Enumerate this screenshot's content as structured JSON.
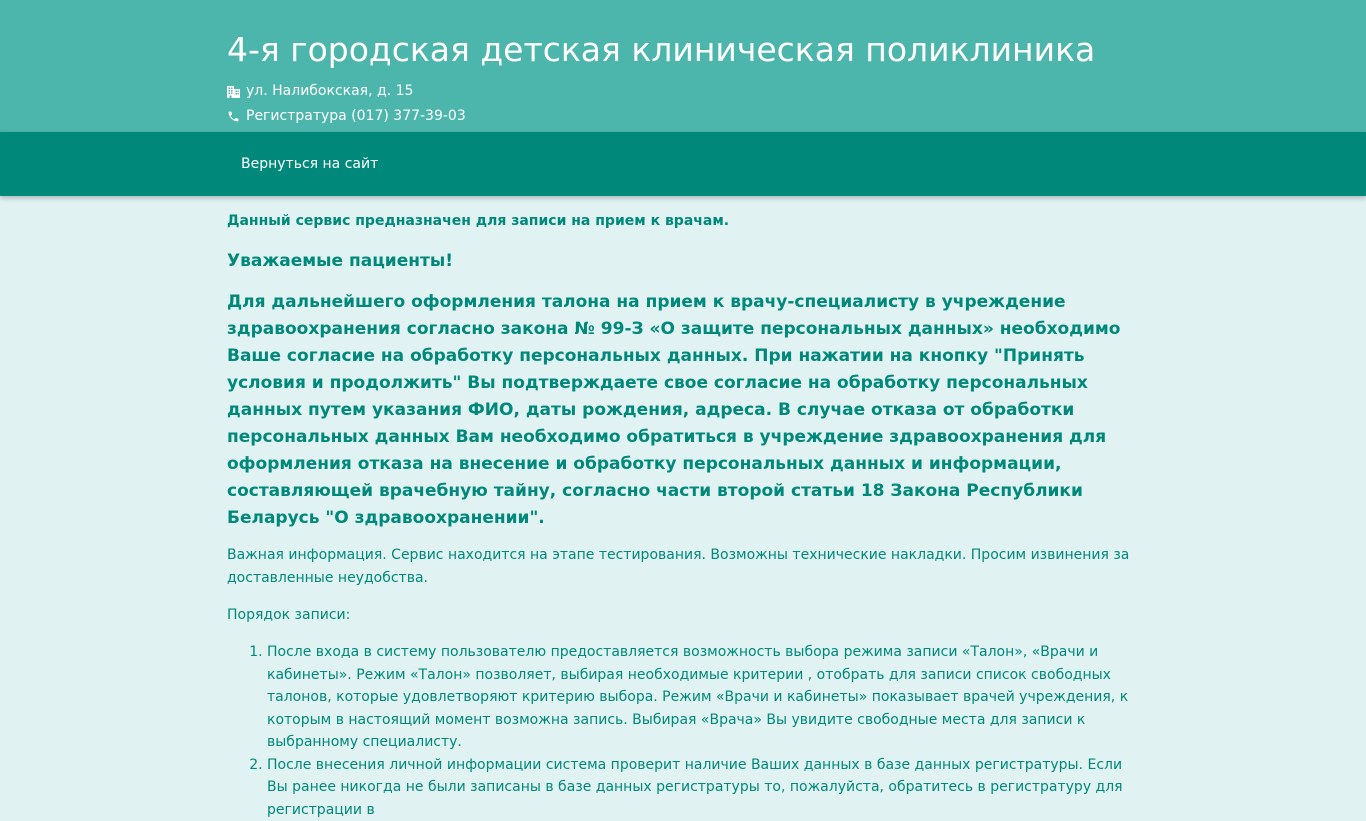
{
  "header": {
    "title": "4-я городская детская клиническая поликлиника",
    "address": "ул. Налибокская, д. 15",
    "address_icon": "building-icon",
    "phone": "Регистратура (017) 377-39-03",
    "phone_icon": "phone-icon"
  },
  "nav": {
    "back_link": "Вернуться на сайт"
  },
  "content": {
    "intro": "Данный сервис предназначен для записи на прием к врачам.",
    "greeting": "Уважаемые пациенты!",
    "consent": "Для дальнейшего оформления талона на прием к врачу-специалисту в учреждение здравоохранения согласно закона № 99-З «О защите персональных данных» необходимо Ваше согласие на обработку персональных данных. При нажатии на кнопку \"Принять условия и продолжить\" Вы подтверждаете свое согласие на обработку персональных данных путем указания ФИО, даты рождения, адреса. В случае отказа от обработки персональных данных Вам необходимо обратиться в учреждение здравоохранения для оформления отказа на внесение и обработку персональных данных и информации, составляющей врачебную тайну, согласно части второй статьи 18 Закона Республики Беларусь \"О здравоохранении\".",
    "notice": "Важная информация. Сервис находится на этапе тестирования. Возможны технические накладки. Просим извинения за доставленные неудобства.",
    "order_title": "Порядок записи:",
    "steps": [
      "После входа в систему пользователю предоставляется возможность выбора режима записи «Талон», «Врачи и кабинеты». Режим «Талон» позволяет, выбирая необходимые критерии , отобрать для записи список свободных талонов, которые удовлетворяют критерию выбора. Режим «Врачи и кабинеты» показывает врачей учреждения, к которым в настоящий момент возможна запись. Выбирая «Врача» Вы увидите свободные места для записи к выбранному специалисту.",
      "После внесения личной информации система проверит наличие Ваших данных  в базе данных регистратуры. Если Вы ранее никогда не были записаны в базе данных регистратуры то, пожалуйста, обратитесь в регистратуру для регистрации в"
    ]
  },
  "colors": {
    "header_bg": "#4db6ac",
    "navbar_bg": "#00897b",
    "page_bg": "#e0f2f1",
    "text": "#00897b"
  }
}
